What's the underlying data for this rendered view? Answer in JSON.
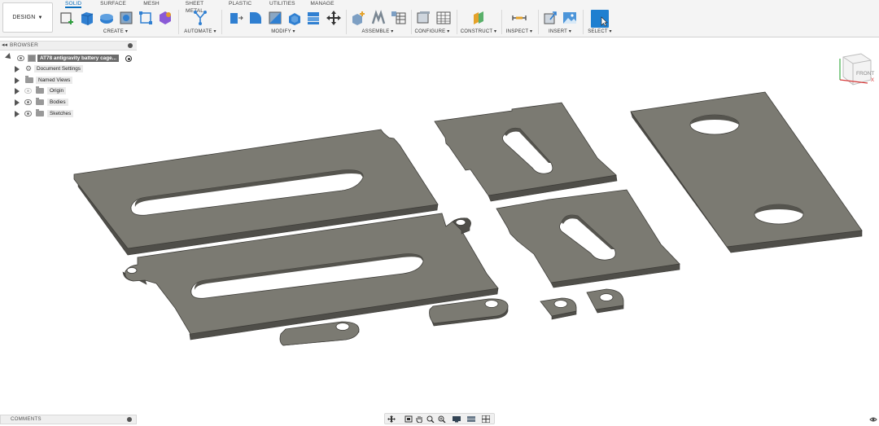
{
  "toolbar": {
    "workspace": "DESIGN",
    "tabs": [
      "SOLID",
      "SURFACE",
      "MESH",
      "SHEET METAL",
      "PLASTIC",
      "UTILITIES",
      "MANAGE"
    ],
    "active_tab": "SOLID",
    "groups": [
      "CREATE",
      "AUTOMATE",
      "MODIFY",
      "ASSEMBLE",
      "CONFIGURE",
      "CONSTRUCT",
      "INSPECT",
      "INSERT",
      "SELECT"
    ],
    "accent_color": "#0a6ebd"
  },
  "browser": {
    "title": "BROWSER",
    "items": [
      {
        "label": "AT78 antigravity battery cage..."
      },
      {
        "label": "Document Settings"
      },
      {
        "label": "Named Views"
      },
      {
        "label": "Origin"
      },
      {
        "label": "Bodies"
      },
      {
        "label": "Sketches"
      }
    ]
  },
  "viewcube": {
    "face": "FRONT"
  },
  "comments": {
    "title": "COMMENTS"
  },
  "colors": {
    "part_top": "#7b7a72",
    "part_edge": "#4f4e49",
    "background": "#ffffff"
  }
}
